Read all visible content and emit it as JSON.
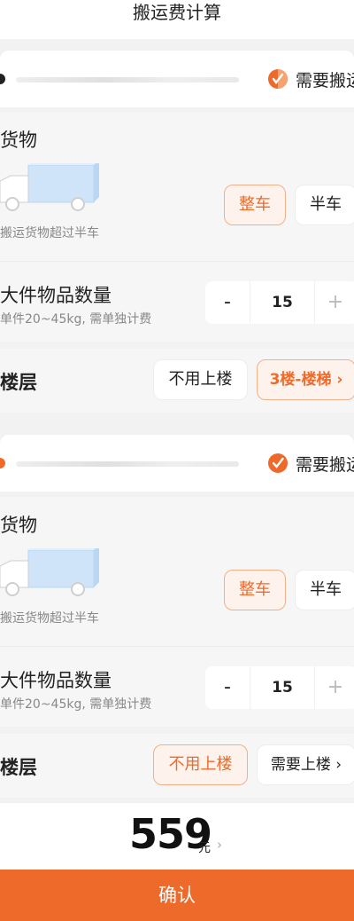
{
  "header": {
    "title": "搬运费计算"
  },
  "sections": [
    {
      "address": {
        "need_label": "需要搬运"
      },
      "cargo": {
        "title": "货物",
        "subtitle": "搬运货物超过半车",
        "option_full": "整车",
        "option_half": "半车",
        "selected": "整车"
      },
      "bulky": {
        "title": "大件物品数量",
        "subtitle": "单件20~45kg, 需单独计费",
        "minus": "-",
        "value": "15",
        "plus": "+"
      },
      "floor": {
        "title": "楼层",
        "option_no": "不用上楼",
        "option_yes": "3楼-楼梯 ›",
        "selected": "3楼-楼梯"
      }
    },
    {
      "address": {
        "need_label": "需要搬运"
      },
      "cargo": {
        "title": "货物",
        "subtitle": "搬运货物超过半车",
        "option_full": "整车",
        "option_half": "半车",
        "selected": "整车"
      },
      "bulky": {
        "title": "大件物品数量",
        "subtitle": "单件20~45kg, 需单独计费",
        "minus": "-",
        "value": "15",
        "plus": "+"
      },
      "floor": {
        "title": "楼层",
        "option_no": "不用上楼",
        "option_yes": "需要上楼 ›",
        "selected": "不用上楼"
      }
    }
  ],
  "total": {
    "amount": "559",
    "unit": "元",
    "arrow": "›"
  },
  "confirm": {
    "label": "确认"
  },
  "colors": {
    "accent": "#ee6a2a",
    "accent_bg": "#fdf3ec",
    "page_bg": "#f2f2f2"
  }
}
